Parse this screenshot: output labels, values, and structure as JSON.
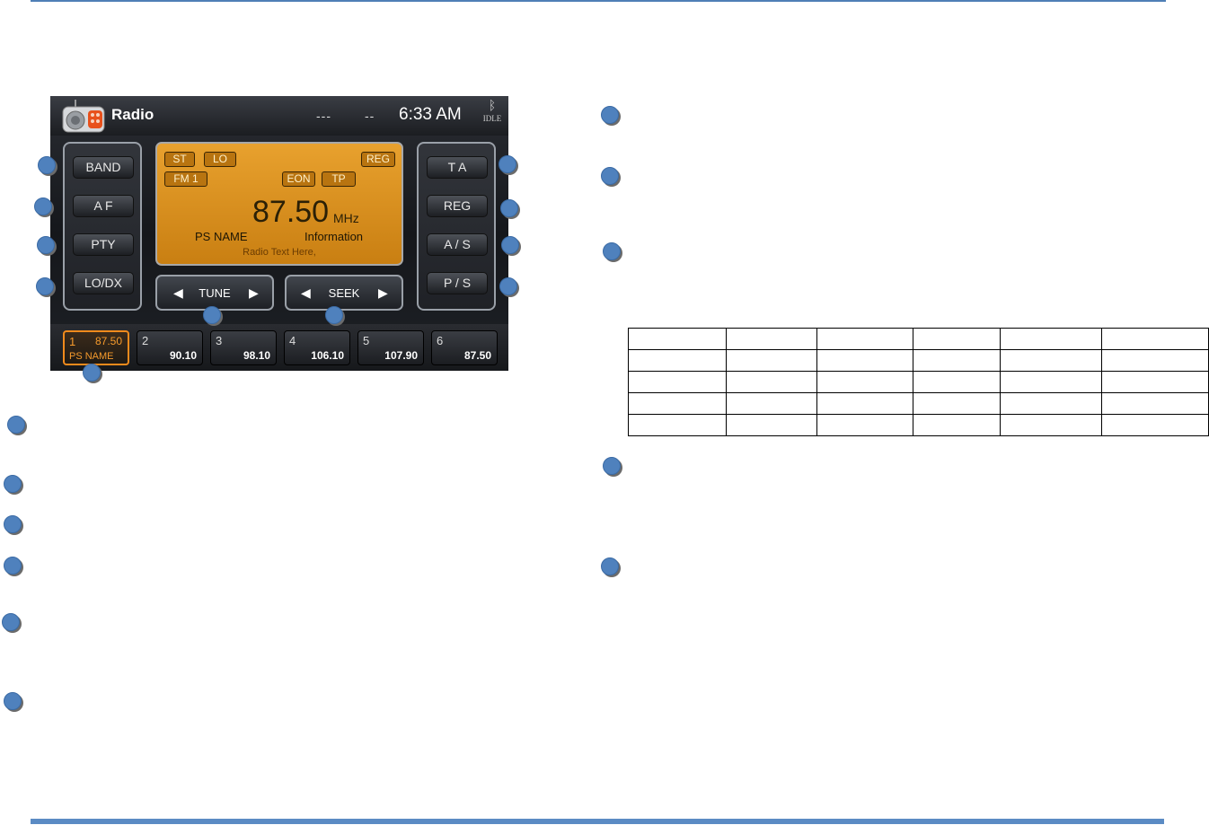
{
  "radio": {
    "status": {
      "title": "Radio",
      "dash1": "---",
      "dash2": "--",
      "time": "6:33 AM",
      "bt_label": "IDLE"
    },
    "left_buttons": [
      "BAND",
      "A F",
      "PTY",
      "LO/DX"
    ],
    "right_buttons": [
      "T A",
      "REG",
      "A / S",
      "P / S"
    ],
    "display": {
      "tag_st": "ST",
      "tag_lo": "LO",
      "tag_reg": "REG",
      "tag_band": "FM 1",
      "tag_eon": "EON",
      "tag_tp": "TP",
      "frequency": "87.50",
      "unit": "MHz",
      "ps_name": "PS NAME",
      "information": "Information",
      "radio_text": "Radio Text Here,"
    },
    "tune_label": "TUNE",
    "seek_label": "SEEK",
    "presets": [
      {
        "num": "1",
        "freq": "87.50",
        "ps": "PS NAME"
      },
      {
        "num": "2",
        "freq": "90.10"
      },
      {
        "num": "3",
        "freq": "98.10"
      },
      {
        "num": "4",
        "freq": "106.10"
      },
      {
        "num": "5",
        "freq": "107.90"
      },
      {
        "num": "6",
        "freq": "87.50"
      }
    ]
  },
  "colors": {
    "accent_blue": "#4f81bd",
    "display_amber": "#e8a12e",
    "preset_active": "#f08a1c"
  }
}
